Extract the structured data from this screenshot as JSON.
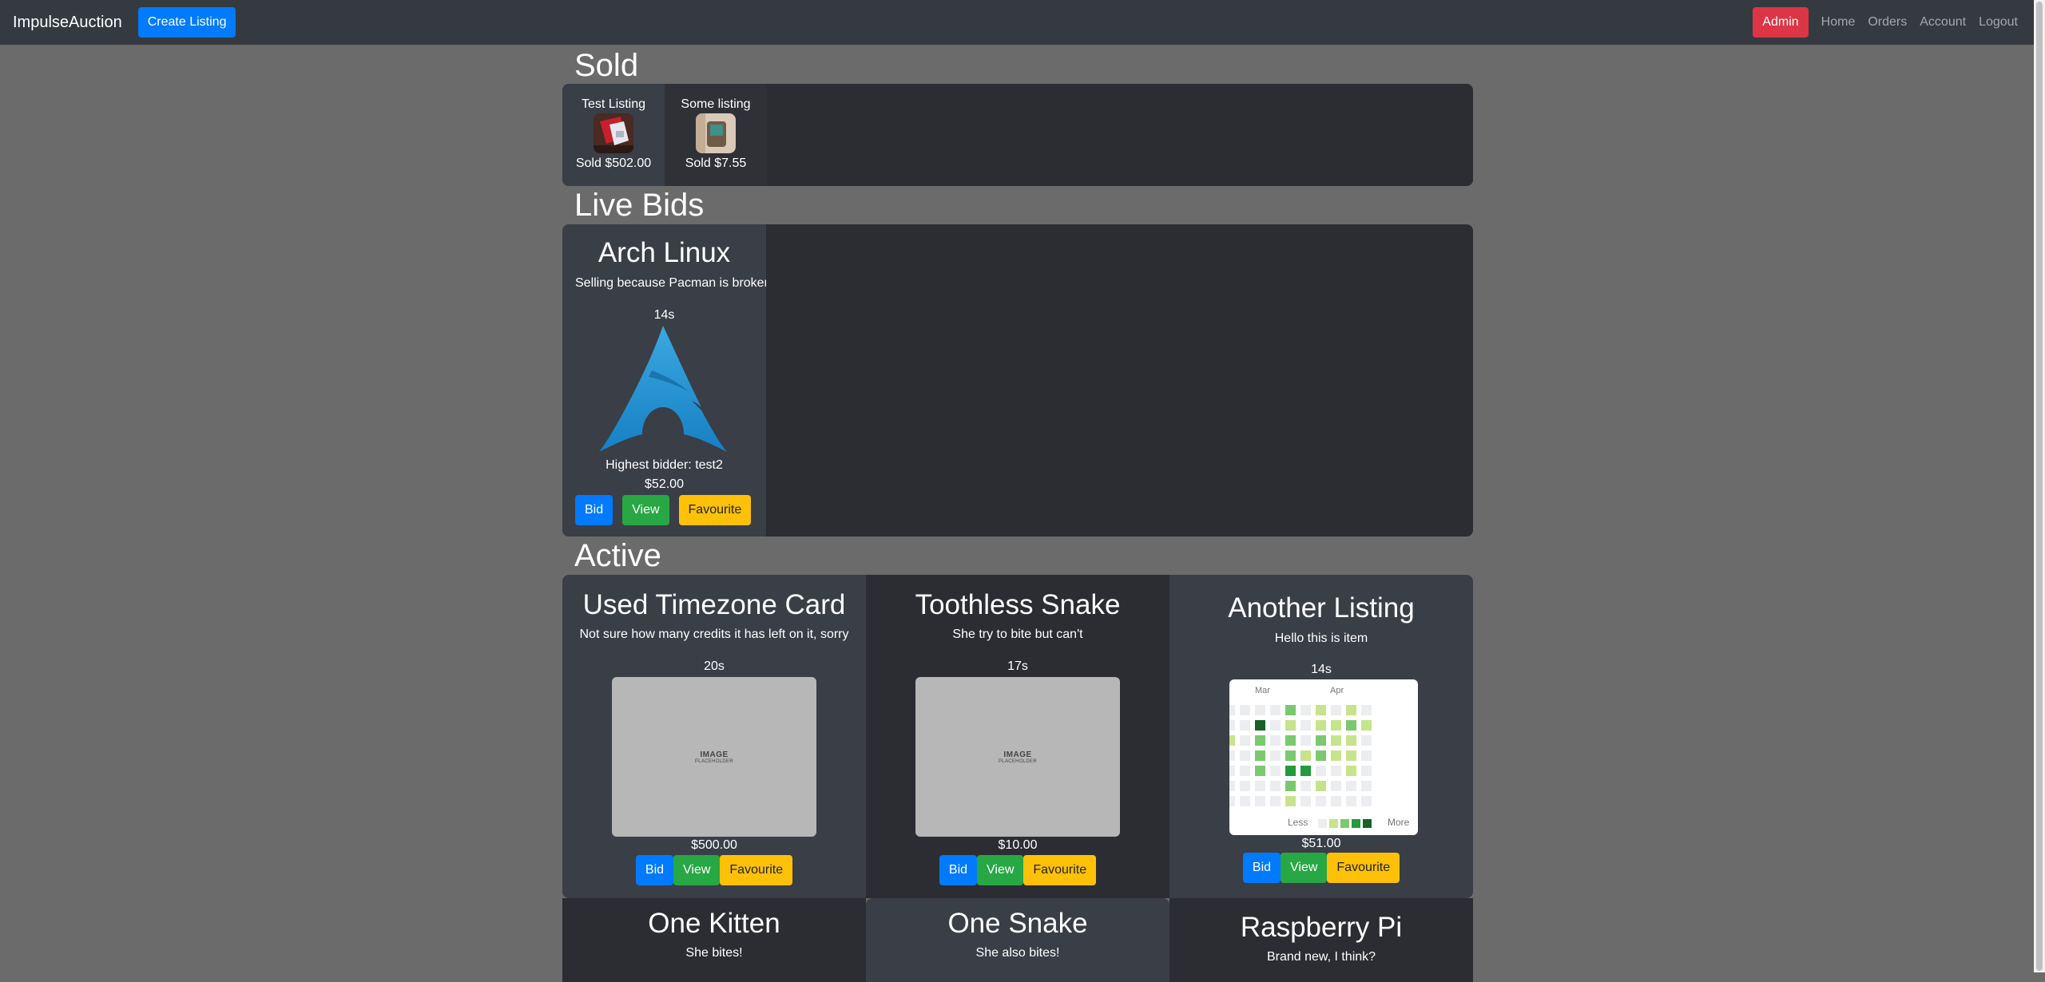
{
  "navbar": {
    "brand": "ImpulseAuction",
    "create_listing": "Create Listing",
    "admin": "Admin",
    "links": [
      "Home",
      "Orders",
      "Account",
      "Logout"
    ]
  },
  "sections": {
    "sold": "Sold",
    "live_bids": "Live Bids",
    "active": "Active"
  },
  "sold_items": [
    {
      "name": "Test Listing",
      "price": "Sold $502.00"
    },
    {
      "name": "Some listing",
      "price": "Sold $7.55"
    }
  ],
  "live_bid": {
    "title": "Arch Linux",
    "description": "Selling because Pacman is broken",
    "time": "14s",
    "highest_bidder": "Highest bidder: test2",
    "price": "$52.00"
  },
  "buttons": {
    "bid": "Bid",
    "view": "View",
    "favourite": "Favourite"
  },
  "placeholder": {
    "main": "IMAGE",
    "sub": "PLACEHOLDER"
  },
  "active_listings": [
    {
      "title": "Used Timezone Card",
      "description": "Not sure how many credits it has left on it, sorry",
      "time": "20s",
      "price": "$500.00"
    },
    {
      "title": "Toothless Snake",
      "description": "She try to bite but can't",
      "time": "17s",
      "price": "$10.00"
    },
    {
      "title": "Another Listing",
      "description": "Hello this is item",
      "time": "14s",
      "price": "$51.00"
    },
    {
      "title": "One Kitten",
      "description": "She bites!"
    },
    {
      "title": "One Snake",
      "description": "She also bites!"
    },
    {
      "title": "Raspberry Pi",
      "description": "Brand new, I think?"
    }
  ],
  "heatmap": {
    "months": [
      "Mar",
      "Apr"
    ],
    "less": "Less",
    "more": "More",
    "colors": [
      "#ebedf0",
      "#c6e48b",
      "#7bc96f",
      "#239a3b",
      "#196127"
    ]
  },
  "colors": {
    "page_bg": "#6b6b6b",
    "navbar_bg": "#343a40",
    "panel_bg": "#2c2d32",
    "card_light": "#3a3e46",
    "primary": "#007bff",
    "success": "#28a745",
    "warning": "#ffc107",
    "danger": "#dc3545"
  }
}
